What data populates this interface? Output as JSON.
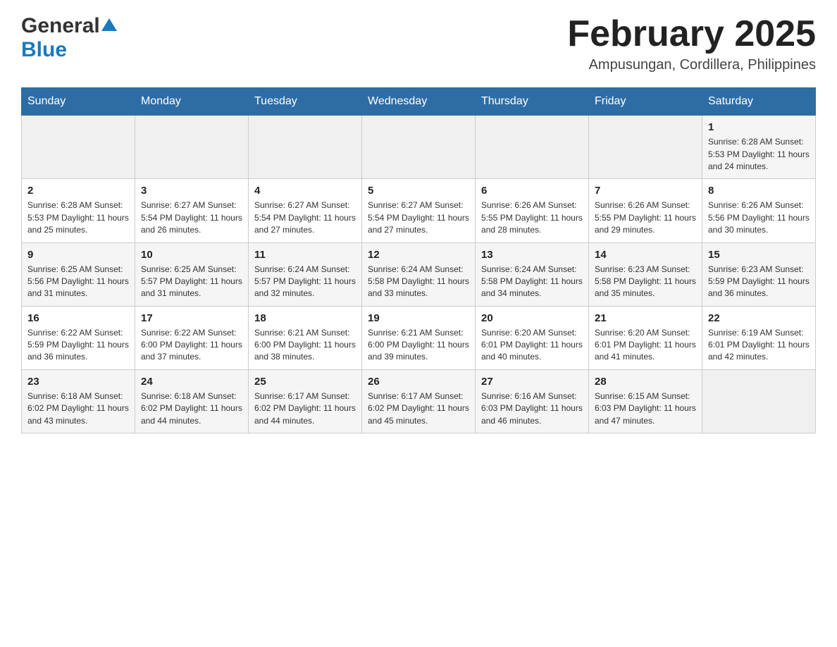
{
  "header": {
    "logo": {
      "general": "General",
      "arrow": "▲",
      "blue": "Blue"
    },
    "title": "February 2025",
    "location": "Ampusungan, Cordillera, Philippines"
  },
  "calendar": {
    "days_of_week": [
      "Sunday",
      "Monday",
      "Tuesday",
      "Wednesday",
      "Thursday",
      "Friday",
      "Saturday"
    ],
    "weeks": [
      [
        {
          "day": "",
          "info": ""
        },
        {
          "day": "",
          "info": ""
        },
        {
          "day": "",
          "info": ""
        },
        {
          "day": "",
          "info": ""
        },
        {
          "day": "",
          "info": ""
        },
        {
          "day": "",
          "info": ""
        },
        {
          "day": "1",
          "info": "Sunrise: 6:28 AM\nSunset: 5:53 PM\nDaylight: 11 hours and 24 minutes."
        }
      ],
      [
        {
          "day": "2",
          "info": "Sunrise: 6:28 AM\nSunset: 5:53 PM\nDaylight: 11 hours and 25 minutes."
        },
        {
          "day": "3",
          "info": "Sunrise: 6:27 AM\nSunset: 5:54 PM\nDaylight: 11 hours and 26 minutes."
        },
        {
          "day": "4",
          "info": "Sunrise: 6:27 AM\nSunset: 5:54 PM\nDaylight: 11 hours and 27 minutes."
        },
        {
          "day": "5",
          "info": "Sunrise: 6:27 AM\nSunset: 5:54 PM\nDaylight: 11 hours and 27 minutes."
        },
        {
          "day": "6",
          "info": "Sunrise: 6:26 AM\nSunset: 5:55 PM\nDaylight: 11 hours and 28 minutes."
        },
        {
          "day": "7",
          "info": "Sunrise: 6:26 AM\nSunset: 5:55 PM\nDaylight: 11 hours and 29 minutes."
        },
        {
          "day": "8",
          "info": "Sunrise: 6:26 AM\nSunset: 5:56 PM\nDaylight: 11 hours and 30 minutes."
        }
      ],
      [
        {
          "day": "9",
          "info": "Sunrise: 6:25 AM\nSunset: 5:56 PM\nDaylight: 11 hours and 31 minutes."
        },
        {
          "day": "10",
          "info": "Sunrise: 6:25 AM\nSunset: 5:57 PM\nDaylight: 11 hours and 31 minutes."
        },
        {
          "day": "11",
          "info": "Sunrise: 6:24 AM\nSunset: 5:57 PM\nDaylight: 11 hours and 32 minutes."
        },
        {
          "day": "12",
          "info": "Sunrise: 6:24 AM\nSunset: 5:58 PM\nDaylight: 11 hours and 33 minutes."
        },
        {
          "day": "13",
          "info": "Sunrise: 6:24 AM\nSunset: 5:58 PM\nDaylight: 11 hours and 34 minutes."
        },
        {
          "day": "14",
          "info": "Sunrise: 6:23 AM\nSunset: 5:58 PM\nDaylight: 11 hours and 35 minutes."
        },
        {
          "day": "15",
          "info": "Sunrise: 6:23 AM\nSunset: 5:59 PM\nDaylight: 11 hours and 36 minutes."
        }
      ],
      [
        {
          "day": "16",
          "info": "Sunrise: 6:22 AM\nSunset: 5:59 PM\nDaylight: 11 hours and 36 minutes."
        },
        {
          "day": "17",
          "info": "Sunrise: 6:22 AM\nSunset: 6:00 PM\nDaylight: 11 hours and 37 minutes."
        },
        {
          "day": "18",
          "info": "Sunrise: 6:21 AM\nSunset: 6:00 PM\nDaylight: 11 hours and 38 minutes."
        },
        {
          "day": "19",
          "info": "Sunrise: 6:21 AM\nSunset: 6:00 PM\nDaylight: 11 hours and 39 minutes."
        },
        {
          "day": "20",
          "info": "Sunrise: 6:20 AM\nSunset: 6:01 PM\nDaylight: 11 hours and 40 minutes."
        },
        {
          "day": "21",
          "info": "Sunrise: 6:20 AM\nSunset: 6:01 PM\nDaylight: 11 hours and 41 minutes."
        },
        {
          "day": "22",
          "info": "Sunrise: 6:19 AM\nSunset: 6:01 PM\nDaylight: 11 hours and 42 minutes."
        }
      ],
      [
        {
          "day": "23",
          "info": "Sunrise: 6:18 AM\nSunset: 6:02 PM\nDaylight: 11 hours and 43 minutes."
        },
        {
          "day": "24",
          "info": "Sunrise: 6:18 AM\nSunset: 6:02 PM\nDaylight: 11 hours and 44 minutes."
        },
        {
          "day": "25",
          "info": "Sunrise: 6:17 AM\nSunset: 6:02 PM\nDaylight: 11 hours and 44 minutes."
        },
        {
          "day": "26",
          "info": "Sunrise: 6:17 AM\nSunset: 6:02 PM\nDaylight: 11 hours and 45 minutes."
        },
        {
          "day": "27",
          "info": "Sunrise: 6:16 AM\nSunset: 6:03 PM\nDaylight: 11 hours and 46 minutes."
        },
        {
          "day": "28",
          "info": "Sunrise: 6:15 AM\nSunset: 6:03 PM\nDaylight: 11 hours and 47 minutes."
        },
        {
          "day": "",
          "info": ""
        }
      ]
    ]
  }
}
